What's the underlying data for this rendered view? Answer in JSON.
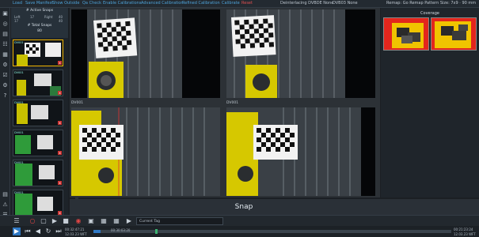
{
  "menu": {
    "items": [
      "Load",
      "Save Manifest",
      "Show Outside",
      "Qa Check",
      "Enable Calibrations",
      "Advanced Calibration",
      "Refined Calibration",
      "Calibrate",
      "Reset"
    ],
    "device_text": "Deinterlacing DVBDE None",
    "device_text2": "DVB03 None",
    "remap_text": "Remap: Go Remap Pattern Size: 7x9 · 90 mm"
  },
  "left_icons": [
    "video-icon",
    "snapshot-icon",
    "folder-icon",
    "settings-icon",
    "grid-icon",
    "calibrate-icon",
    "checkbox-icon",
    "gear-icon",
    "help-icon"
  ],
  "snap_panel": {
    "active_snaps_label": "# Active Snaps",
    "total_snaps_label": "# Total Snaps",
    "col_left_label": "Left",
    "col_right_label": "Right",
    "left_active": "17",
    "left_total": "17",
    "right_active": "40",
    "right_total": "40",
    "total_value": "80",
    "thumb_labels": [
      "DV001",
      "DV001",
      "DV001",
      "DV001",
      "DV001",
      "DV001",
      "DV001"
    ]
  },
  "cameras": {
    "bottom_left_label": "DV001",
    "bottom_right_label": "DV001"
  },
  "coverage": {
    "title": "Coverage"
  },
  "snap_button": {
    "label": "Snap"
  },
  "toolbar": {
    "tag_placeholder": "Current Tag"
  },
  "timeline": {
    "start_time": "00:32:47:21",
    "start_date": "12.03.23 WFT",
    "mid_time": "00:30:03:20",
    "end_time": "00:21:23:24",
    "end_date": "12.03.23 WFT",
    "progress": 0.02
  },
  "colors": {
    "accent": "#2f78c4",
    "menu_link": "#4ea3d9",
    "reset": "#e05050",
    "active_border": "#f0b400"
  }
}
